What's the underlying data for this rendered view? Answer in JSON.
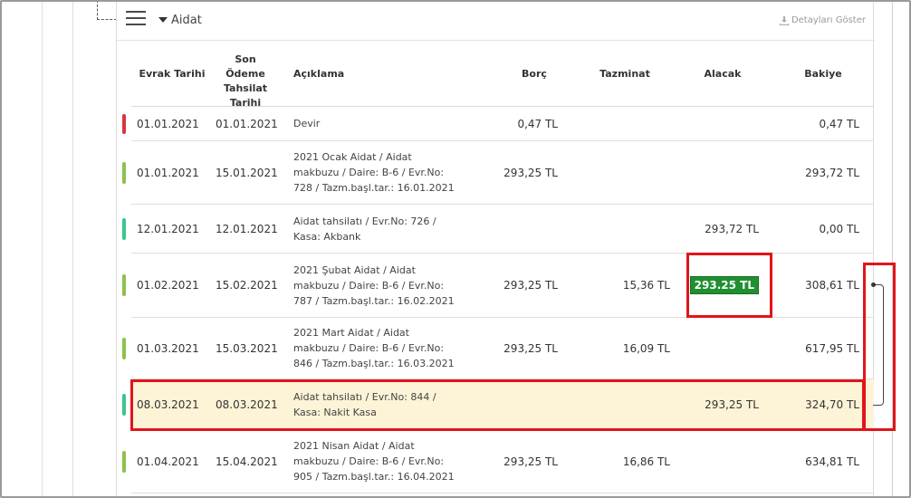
{
  "section": {
    "title": "Aidat",
    "details_label": "Detayları Göster"
  },
  "columns": {
    "evrak_tarihi": "Evrak Tarihi",
    "son_odeme": "Son Ödeme Tahsilat Tarihi",
    "aciklama": "Açıklama",
    "borc": "Borç",
    "tazminat": "Tazminat",
    "alacak": "Alacak",
    "bakiye": "Bakiye"
  },
  "colors": {
    "bar_red": "#d9363e",
    "bar_olive": "#8bc34a",
    "bar_teal": "#3cc68a",
    "highlight": "#fdf3d6",
    "callout_red": "#e1141b",
    "pill_green": "#1f8f2f"
  },
  "rows": [
    {
      "date": "01.01.2021",
      "due": "01.01.2021",
      "desc": "Devir",
      "borc": "0,47 TL",
      "tazminat": "",
      "alacak": "",
      "bakiye": "0,47 TL",
      "bar": "red"
    },
    {
      "date": "01.01.2021",
      "due": "15.01.2021",
      "desc": "2021 Ocak Aidat / Aidat makbuzu / Daire: B-6 / Evr.No: 728 / Tazm.başl.tar.: 16.01.2021",
      "borc": "293,25 TL",
      "tazminat": "",
      "alacak": "",
      "bakiye": "293,72 TL",
      "bar": "olive"
    },
    {
      "date": "12.01.2021",
      "due": "12.01.2021",
      "desc": "Aidat tahsilatı / Evr.No: 726 / Kasa: Akbank",
      "borc": "",
      "tazminat": "",
      "alacak": "293,72 TL",
      "bakiye": "0,00 TL",
      "bar": "teal"
    },
    {
      "date": "01.02.2021",
      "due": "15.02.2021",
      "desc": "2021 Şubat Aidat / Aidat makbuzu / Daire: B-6 / Evr.No: 787 / Tazm.başl.tar.: 16.02.2021",
      "borc": "293,25 TL",
      "tazminat": "15,36 TL",
      "alacak": "293.25 TL",
      "bakiye": "308,61 TL",
      "bar": "olive",
      "alacak_highlight": true
    },
    {
      "date": "01.03.2021",
      "due": "15.03.2021",
      "desc": "2021 Mart Aidat / Aidat makbuzu / Daire: B-6 / Evr.No: 846 / Tazm.başl.tar.: 16.03.2021",
      "borc": "293,25 TL",
      "tazminat": "16,09 TL",
      "alacak": "",
      "bakiye": "617,95 TL",
      "bar": "olive"
    },
    {
      "date": "08.03.2021",
      "due": "08.03.2021",
      "desc": "Aidat tahsilatı / Evr.No: 844 / Kasa: Nakit Kasa",
      "borc": "",
      "tazminat": "",
      "alacak": "293,25 TL",
      "bakiye": "324,70 TL",
      "bar": "teal",
      "highlighted": true
    },
    {
      "date": "01.04.2021",
      "due": "15.04.2021",
      "desc": "2021 Nisan Aidat / Aidat makbuzu / Daire: B-6 / Evr.No: 905 / Tazm.başl.tar.: 16.04.2021",
      "borc": "293,25 TL",
      "tazminat": "16,86 TL",
      "alacak": "",
      "bakiye": "634,81 TL",
      "bar": "olive"
    }
  ]
}
